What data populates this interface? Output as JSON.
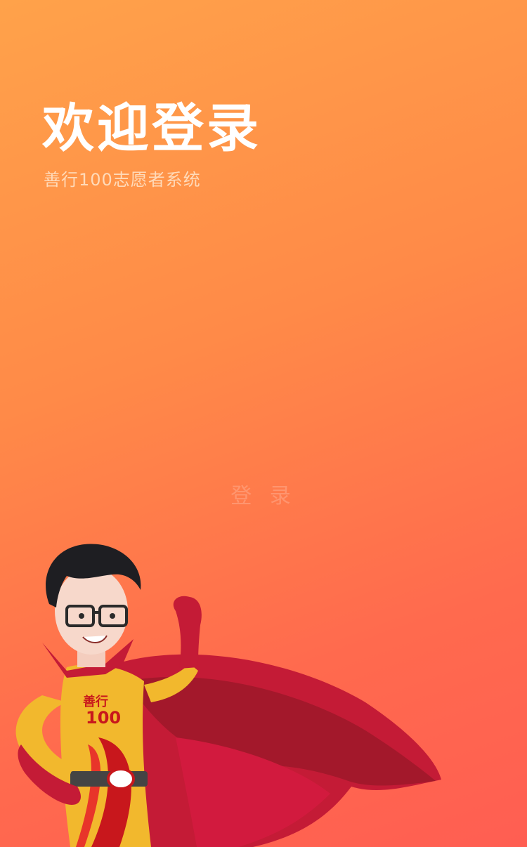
{
  "header": {
    "title": "欢迎登录",
    "subtitle": "善行100志愿者系统"
  },
  "actions": {
    "login_label": "登 录"
  },
  "mascot": {
    "badge_text": "善行",
    "badge_number": "100"
  },
  "colors": {
    "bg_top": "#FFA24A",
    "bg_bottom": "#FF5E52",
    "cape": "#C41B36",
    "suit": "#F2B82D"
  }
}
